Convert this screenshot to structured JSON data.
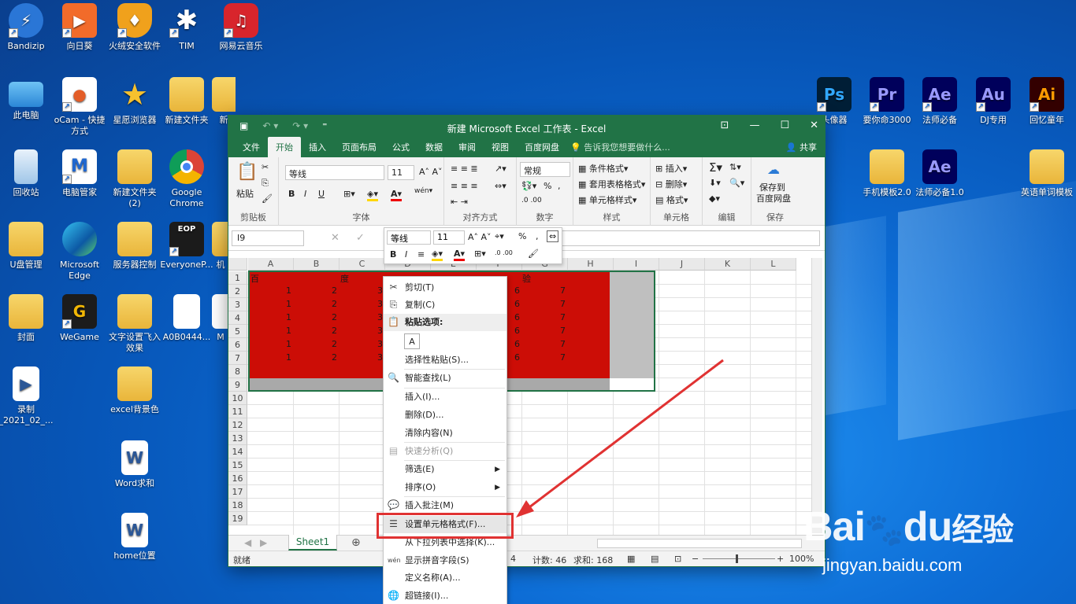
{
  "desktop": {
    "icons": [
      {
        "label": "Bandizip"
      },
      {
        "label": "向日葵"
      },
      {
        "label": "火绒安全软件"
      },
      {
        "label": "TIM"
      },
      {
        "label": "网易云音乐"
      },
      {
        "label": "此电脑"
      },
      {
        "label": "oCam - 快捷方式"
      },
      {
        "label": "星愿浏览器"
      },
      {
        "label": "新建文件夹"
      },
      {
        "label": "新"
      },
      {
        "label": "回收站"
      },
      {
        "label": "电脑管家"
      },
      {
        "label": "新建文件夹 (2)"
      },
      {
        "label": "Google Chrome"
      },
      {
        "label": "U盘管理"
      },
      {
        "label": "Microsoft Edge"
      },
      {
        "label": "服务器控制"
      },
      {
        "label": "EveryoneP..."
      },
      {
        "label": "机"
      },
      {
        "label": "封面"
      },
      {
        "label": "WeGame"
      },
      {
        "label": "文字设置飞入效果"
      },
      {
        "label": "A0B0444..."
      },
      {
        "label": "M"
      },
      {
        "label": "录制 _2021_02_..."
      },
      {
        "label": "excel背景色"
      },
      {
        "label": "Word求和"
      },
      {
        "label": "home位置"
      },
      {
        "label": "头像器"
      },
      {
        "label": "要你命3000"
      },
      {
        "label": "法师必备"
      },
      {
        "label": "DJ专用"
      },
      {
        "label": "回忆童年"
      },
      {
        "label": "手机模板2.0"
      },
      {
        "label": "法师必备1.0"
      },
      {
        "label": "英语单词模板"
      }
    ],
    "icon_texts": {
      "ps": "Ps",
      "pr": "Pr",
      "ae": "Ae",
      "au": "Au",
      "ai": "Ai",
      "eop": "EOP"
    }
  },
  "excel": {
    "title": "新建 Microsoft Excel 工作表 - Excel",
    "tabs": [
      "文件",
      "开始",
      "插入",
      "页面布局",
      "公式",
      "数据",
      "审阅",
      "视图",
      "百度网盘"
    ],
    "tell_me": "告诉我您想要做什么...",
    "share": "共享",
    "ribbon": {
      "paste": "粘贴",
      "clipboard": "剪贴板",
      "font_name": "等线",
      "font_size": "11",
      "font_group": "字体",
      "align_group": "对齐方式",
      "number_format": "常规",
      "number_group": "数字",
      "cond_format": "条件格式",
      "table_format": "套用表格格式",
      "cell_style": "单元格样式",
      "style_group": "样式",
      "insert": "插入",
      "delete": "删除",
      "format": "格式",
      "cells_group": "单元格",
      "edit_group": "编辑",
      "save_to": "保存到",
      "baidu_pan": "百度网盘",
      "save_group": "保存",
      "bold": "B",
      "italic": "I",
      "underline": "U",
      "percent": "%",
      "comma": ",",
      "font_color_a": "A",
      "wen": "wén"
    },
    "name_box": "I9",
    "columns": [
      "A",
      "B",
      "C",
      "D",
      "E",
      "F",
      "G",
      "H",
      "I",
      "J",
      "K",
      "L"
    ],
    "rows": [
      "1",
      "2",
      "3",
      "4",
      "5",
      "6",
      "7",
      "8",
      "9",
      "10",
      "11",
      "12",
      "13",
      "14",
      "15",
      "16",
      "17",
      "18",
      "19"
    ],
    "row1": [
      "百",
      "度",
      "验"
    ],
    "data_values": [
      "1",
      "2",
      "3",
      "6",
      "7"
    ],
    "sheet_tab": "Sheet1",
    "status": {
      "ready": "就绪",
      "count_visible": "4",
      "count": "计数: 46",
      "sum": "求和: 168",
      "zoom": "100%"
    }
  },
  "mini_toolbar": {
    "font": "等线",
    "size": "11",
    "bold": "B",
    "italic": "I",
    "percent": "%",
    "comma": ","
  },
  "context_menu": {
    "cut": "剪切(T)",
    "copy": "复制(C)",
    "paste_options": "粘贴选项:",
    "paste_special": "选择性粘贴(S)...",
    "smart_lookup": "智能查找(L)",
    "insert": "插入(I)...",
    "delete": "删除(D)...",
    "clear": "清除内容(N)",
    "quick_analysis": "快速分析(Q)",
    "filter": "筛选(E)",
    "sort": "排序(O)",
    "insert_comment": "插入批注(M)",
    "format_cells": "设置单元格格式(F)...",
    "pick_list": "从下拉列表中选择(K)...",
    "phonetic": "显示拼音字段(S)",
    "define_name": "定义名称(A)...",
    "hyperlink": "超链接(I)..."
  },
  "watermark": {
    "brand": "Bai",
    "brand2": "du",
    "brand3": "经验",
    "url": "jingyan.baidu.com"
  },
  "colors": {
    "excel_green": "#217346",
    "fill_red": "#cc0d06",
    "highlight": "#e03232"
  }
}
